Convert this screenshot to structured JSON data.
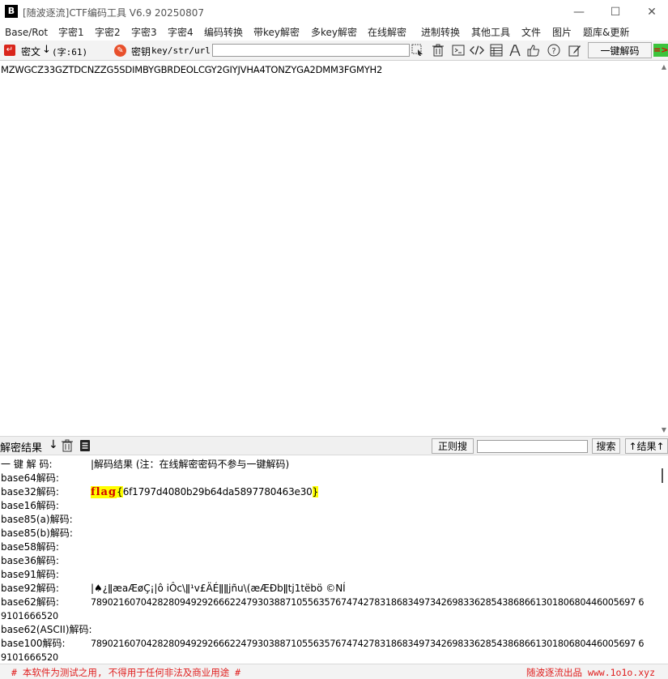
{
  "window": {
    "title": "[随波逐流]CTF编码工具 V6.9  20250807",
    "app_icon": "B",
    "controls": [
      "—",
      "☐",
      "✕"
    ]
  },
  "menu": [
    "Base/Rot",
    "字密1",
    "字密2",
    "字密3",
    "字密4",
    "编码转换",
    "带key解密",
    "多key解密",
    "在线解密",
    "进制转换",
    "其他工具",
    "文件",
    "图片",
    "题库&更新"
  ],
  "toolbar": {
    "cipher_label": "密文",
    "cipher_arrow": "↓",
    "char_count": "(字:61)",
    "key_label": "密钥",
    "key_hint": "key/str/url:",
    "key_value": "",
    "tool_icons": [
      "cursor-icon",
      "trash-icon",
      "terminal-icon",
      "code-icon",
      "table-icon",
      "font-icon",
      "thumbs-up-icon",
      "help-icon",
      "edit-icon"
    ],
    "one_click_decode": "一键解码",
    "right_indicator": "=>"
  },
  "ciphertext": "MZWGCZ33GZTDCNZZG5SDIMBYGBRDEOLCGY2GIYJVHA4TONZYGA2DMM3FGMYH2",
  "result_bar": {
    "label": "解密结果",
    "arrow": "↓",
    "regex_search": "正则搜",
    "search_value": "",
    "search_button": "搜索",
    "result_up": "↑结果↑"
  },
  "results": {
    "header_key": "一 键 解 码:",
    "header_value": "|解码结果 (注：在线解密密码不参与一键解码)",
    "rows": [
      {
        "key": "base64解码:",
        "value": ""
      },
      {
        "key": "base32解码:",
        "value": ""
      },
      {
        "key": "base16解码:",
        "value": ""
      },
      {
        "key": "base85(a)解码:",
        "value": ""
      },
      {
        "key": "base85(b)解码:",
        "value": ""
      },
      {
        "key": "base58解码:",
        "value": ""
      },
      {
        "key": "base36解码:",
        "value": ""
      },
      {
        "key": "base91解码:",
        "value": ""
      },
      {
        "key": "base92解码:",
        "value": "|♠¿ǁæaÆøÇ¡|ô iÔc\\ǁ¹v£ÄÉǁǁjñu\\(æÆÐbǁtj1tëbö ©NÍ"
      },
      {
        "key": "base62解码:",
        "value": "78902160704282809492926662247930388710556357674742783186834973426983362854386866130180680446005697 6"
      },
      {
        "key": "base62(ASCII)解码:",
        "value": ""
      },
      {
        "key": "base100解码:",
        "value": "78902160704282809492926662247930388710556357674742783186834973426983362854386866130180680446005697 6"
      }
    ],
    "base62_wrap": "9101666520",
    "base100_wrap": "9101666520",
    "flag_word": "flag",
    "flag_open": "{",
    "flag_body": "6f1797d4080b29b64da5897780463e30",
    "flag_close": "}"
  },
  "status": {
    "left": "# 本软件为测试之用, 不得用于任何非法及商业用途 #",
    "right": "随波逐流出品 www.1o1o.xyz"
  }
}
